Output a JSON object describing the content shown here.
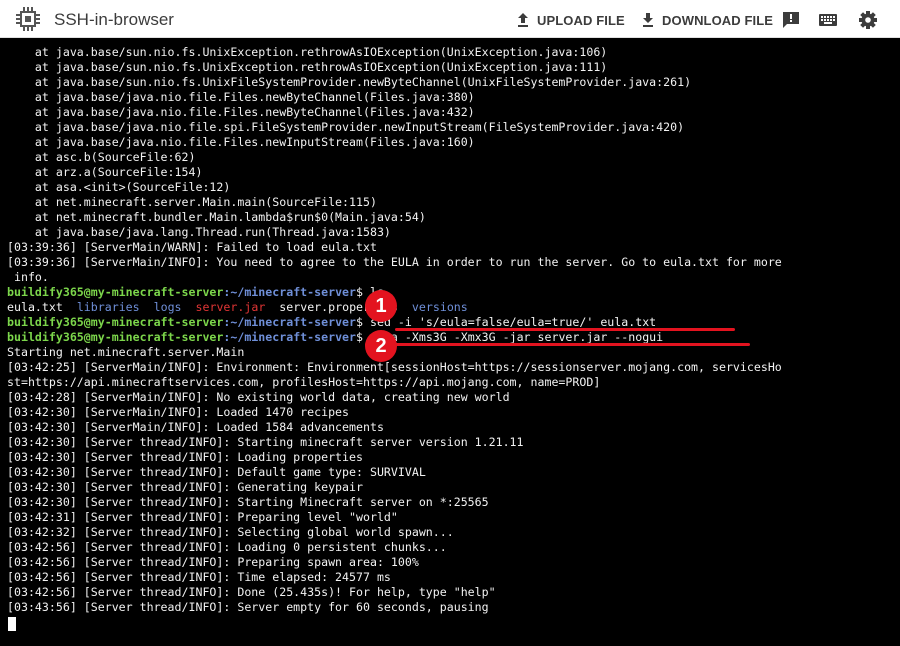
{
  "app": {
    "title": "SSH-in-browser"
  },
  "toolbar": {
    "upload_label": "UPLOAD FILE",
    "download_label": "DOWNLOAD FILE"
  },
  "icons": [
    "chip-icon",
    "upload-icon",
    "download-icon",
    "feedback-icon",
    "keyboard-icon",
    "gear-icon"
  ],
  "colors": {
    "prompt": "#7cd64b",
    "path": "#6f8fd8",
    "jar": "#e03535",
    "annotation": "#e3131f"
  },
  "terminal": {
    "prompt_user": "buildify365@my-minecraft-server",
    "stack": [
      "    at java.base/sun.nio.fs.UnixException.rethrowAsIOException(UnixException.java:106)",
      "    at java.base/sun.nio.fs.UnixException.rethrowAsIOException(UnixException.java:111)",
      "    at java.base/sun.nio.fs.UnixFileSystemProvider.newByteChannel(UnixFileSystemProvider.java:261)",
      "    at java.base/java.nio.file.Files.newByteChannel(Files.java:380)",
      "    at java.base/java.nio.file.Files.newByteChannel(Files.java:432)",
      "    at java.base/java.nio.file.spi.FileSystemProvider.newInputStream(FileSystemProvider.java:420)",
      "    at java.base/java.nio.file.Files.newInputStream(Files.java:160)",
      "    at asc.b(SourceFile:62)",
      "    at arz.a(SourceFile:154)",
      "    at asa.<init>(SourceFile:12)",
      "    at net.minecraft.server.Main.main(SourceFile:115)",
      "    at net.minecraft.bundler.Main.lambda$run$0(Main.java:54)",
      "    at java.base/java.lang.Thread.run(Thread.java:1583)"
    ],
    "warn_lines": [
      "[03:39:36] [ServerMain/WARN]: Failed to load eula.txt",
      "[03:39:36] [ServerMain/INFO]: You need to agree to the EULA in order to run the server. Go to eula.txt for more",
      " info."
    ],
    "cmd1": {
      "path": ":~/minecraft-server",
      "dollar": "$ ",
      "cmd": "ls"
    },
    "ls_output": {
      "eula": "eula.txt",
      "libraries": "libraries",
      "logs": "logs",
      "serverjar": "server.jar",
      "properties": "server.properties",
      "versions": "versions"
    },
    "cmd2": {
      "path": ":~/minecraft-server",
      "dollar": "$ ",
      "cmd": "sed -i 's/eula=false/eula=true/' eula.txt"
    },
    "cmd3": {
      "path": ":~/minecraft-server",
      "dollar": "$ ",
      "cmd": "java -Xms3G -Xmx3G -jar server.jar --nogui"
    },
    "output": [
      "Starting net.minecraft.server.Main",
      "[03:42:25] [ServerMain/INFO]: Environment: Environment[sessionHost=https://sessionserver.mojang.com, servicesHo",
      "st=https://api.minecraftservices.com, profilesHost=https://api.mojang.com, name=PROD]",
      "[03:42:28] [ServerMain/INFO]: No existing world data, creating new world",
      "[03:42:30] [ServerMain/INFO]: Loaded 1470 recipes",
      "[03:42:30] [ServerMain/INFO]: Loaded 1584 advancements",
      "[03:42:30] [Server thread/INFO]: Starting minecraft server version 1.21.11",
      "[03:42:30] [Server thread/INFO]: Loading properties",
      "[03:42:30] [Server thread/INFO]: Default game type: SURVIVAL",
      "[03:42:30] [Server thread/INFO]: Generating keypair",
      "[03:42:30] [Server thread/INFO]: Starting Minecraft server on *:25565",
      "[03:42:31] [Server thread/INFO]: Preparing level \"world\"",
      "[03:42:32] [Server thread/INFO]: Selecting global world spawn...",
      "[03:42:56] [Server thread/INFO]: Loading 0 persistent chunks...",
      "[03:42:56] [Server thread/INFO]: Preparing spawn area: 100%",
      "[03:42:56] [Server thread/INFO]: Time elapsed: 24577 ms",
      "[03:42:56] [Server thread/INFO]: Done (25.435s)! For help, type \"help\"",
      "[03:43:56] [Server thread/INFO]: Server empty for 60 seconds, pausing"
    ]
  },
  "annotations": {
    "step1": "1",
    "step2": "2"
  }
}
